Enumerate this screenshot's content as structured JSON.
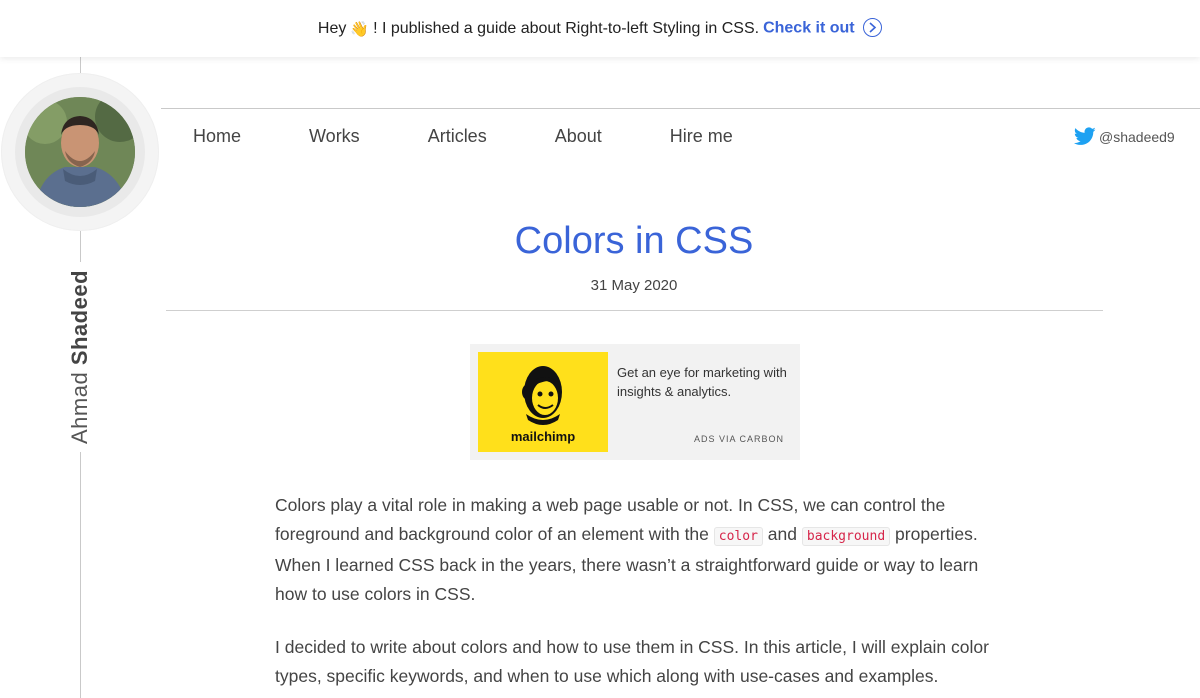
{
  "banner": {
    "greeting": "Hey",
    "wave_emoji": "👋",
    "message": "! I published a guide about Right-to-left Styling in CSS.",
    "cta": "Check it out",
    "cta_color": "#3a64d8"
  },
  "author": {
    "first_name": "Ahmad",
    "last_name": "Shadeed"
  },
  "nav": {
    "items": [
      {
        "label": "Home"
      },
      {
        "label": "Works"
      },
      {
        "label": "Articles"
      },
      {
        "label": "About"
      },
      {
        "label": "Hire me"
      }
    ],
    "twitter_handle": "@shadeed9",
    "twitter_color": "#1da1f2"
  },
  "article": {
    "title": "Colors in CSS",
    "date": "31 May 2020",
    "p1": {
      "text_a": "Colors play a vital role in making a web page usable or not. In CSS, we can control the foreground and background color of an element with the",
      "code_a": "color",
      "text_b": "and",
      "code_b": "background",
      "text_c": "properties. When I learned CSS back in the years, there wasn’t a straightforward guide or way to learn how to use colors in CSS."
    },
    "p2": "I decided to write about colors and how to use them in CSS. In this article, I will explain color types, specific keywords, and when to use which along with use-cases and examples."
  },
  "ad": {
    "brand": "mailchimp",
    "text": "Get an eye for marketing with insights & analytics.",
    "via": "ADS VIA CARBON",
    "brand_color": "#ffe01b"
  }
}
